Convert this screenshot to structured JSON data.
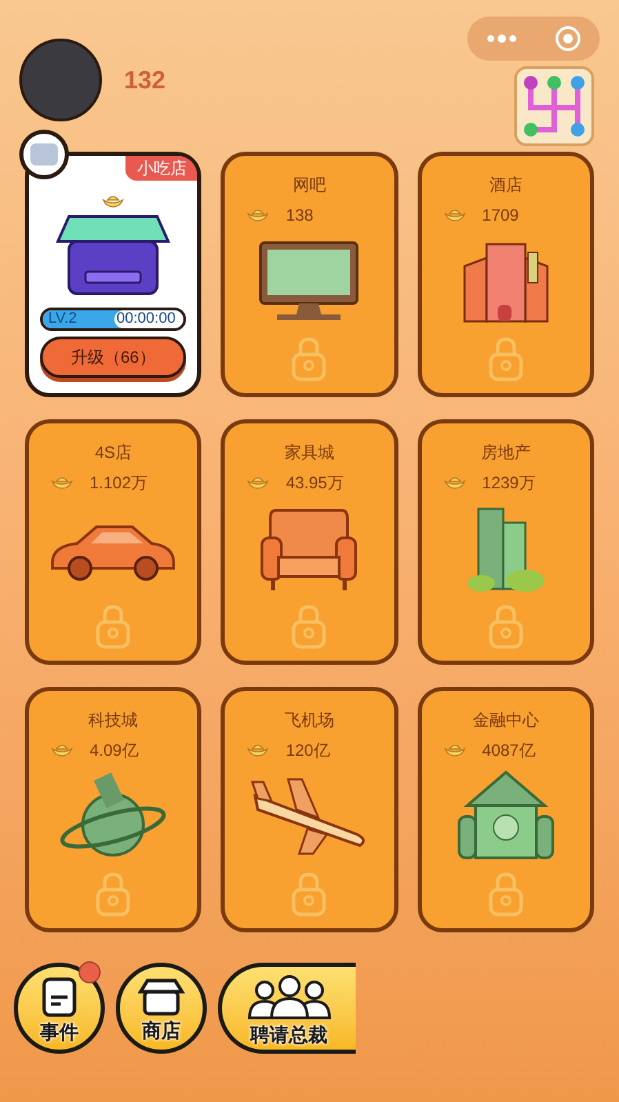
{
  "header": {
    "coins": "132"
  },
  "shops": [
    {
      "kind": "unlocked",
      "name": "小吃店",
      "level_text": "LV.2",
      "timer": "00:00:00",
      "level": 0.6,
      "upgrade": "升级（66）"
    },
    {
      "kind": "locked",
      "name": "网吧",
      "price": "138"
    },
    {
      "kind": "locked",
      "name": "酒店",
      "price": "1709"
    },
    {
      "kind": "locked",
      "name": "4S店",
      "price": "1.102万"
    },
    {
      "kind": "locked",
      "name": "家具城",
      "price": "43.95万"
    },
    {
      "kind": "locked",
      "name": "房地产",
      "price": "1239万"
    },
    {
      "kind": "locked",
      "name": "科技城",
      "price": "4.09亿"
    },
    {
      "kind": "locked",
      "name": "飞机场",
      "price": "120亿"
    },
    {
      "kind": "locked",
      "name": "金融中心",
      "price": "4087亿"
    }
  ],
  "bottom_buttons": [
    {
      "kind": "round",
      "label": "事件",
      "badge": true
    },
    {
      "kind": "round",
      "label": "商店",
      "badge": false
    },
    {
      "kind": "wide",
      "label": "聘请总裁",
      "badge": false
    }
  ]
}
